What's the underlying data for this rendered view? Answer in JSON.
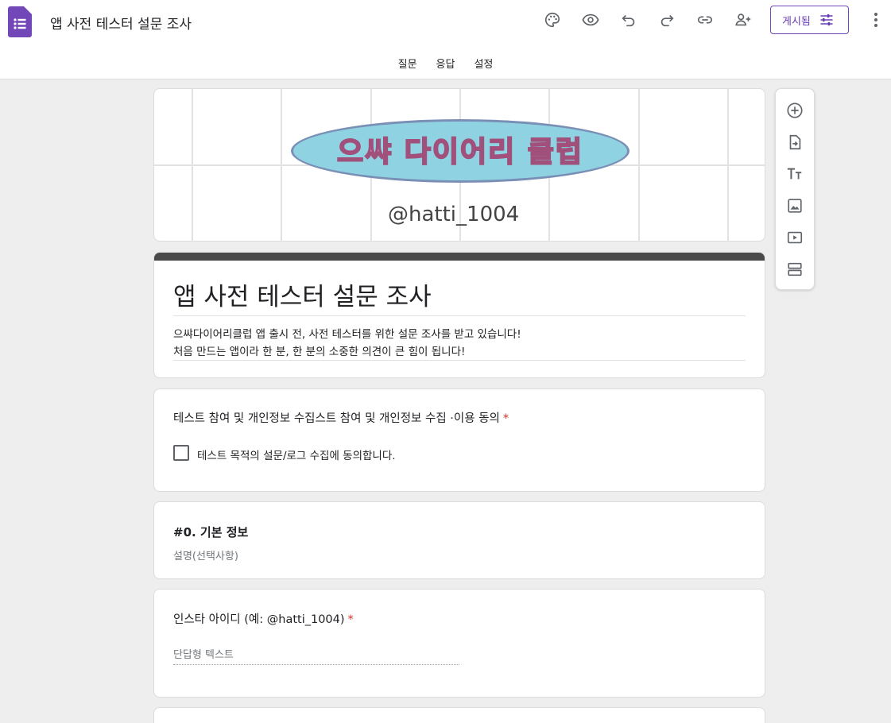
{
  "app": {
    "doc_title": "앱 사전 테스터 설문 조사",
    "brand_color": "#673ab7"
  },
  "toolbar": {
    "icons": [
      "palette-icon",
      "preview-icon",
      "undo-icon",
      "redo-icon",
      "link-icon",
      "add-collaborator-icon"
    ],
    "publish_label": "게시됨"
  },
  "tabs": [
    {
      "label": "질문"
    },
    {
      "label": "응답"
    },
    {
      "label": "설정"
    }
  ],
  "header_image": {
    "logo_text": "으쌰 다이어리 클럽",
    "handle": "@hatti_1004"
  },
  "form": {
    "title": "앱 사전 테스터 설문 조사",
    "description_line1": "으쌰다이어리클럽 앱 출시 전, 사전 테스터를 위한 설문 조사를 받고 있습니다!",
    "description_line2": "처음 만드는 앱이라 한 분, 한 분의 소중한 의견이 큰 힘이 됩니다!"
  },
  "questions": [
    {
      "title": "테스트 참여 및 개인정보 수집스트 참여 및 개인정보 수집 ·이용 동의",
      "required_mark": "*",
      "checkbox_label": "테스트 목적의 설문/로그 수집에 동의합니다."
    },
    {
      "title": "인스타 아이디 (예: @hatti_1004)",
      "required_mark": "*",
      "answer_placeholder": "단답형 텍스트"
    }
  ],
  "section": {
    "title": "#0. 기본 정보",
    "description": "설명(선택사항)"
  },
  "side_toolbar": {
    "icons": [
      "add-question-icon",
      "import-questions-icon",
      "add-title-icon",
      "add-image-icon",
      "add-video-icon",
      "add-section-icon"
    ]
  }
}
